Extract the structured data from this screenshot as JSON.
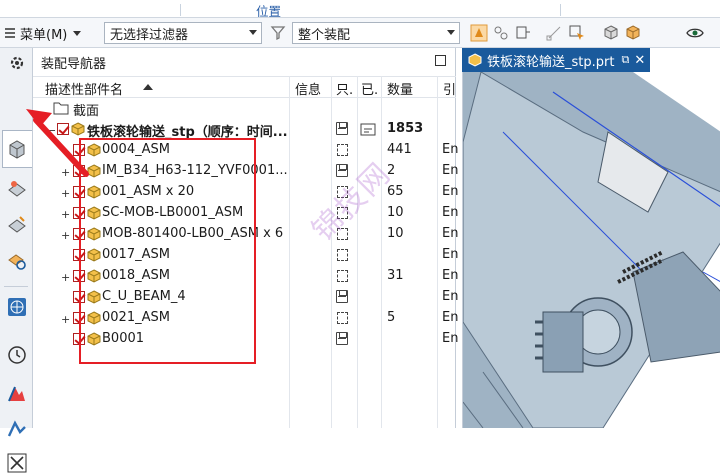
{
  "topbar": {
    "location_label": "位置"
  },
  "toolbar": {
    "menu_label": "菜单(M)",
    "filter_value": "无选择过滤器",
    "scope_value": "整个装配"
  },
  "navigator": {
    "title": "装配导航器",
    "columns": {
      "name": "描述性部件名",
      "info": "信息",
      "readonly": "只.",
      "modified": "已.",
      "quantity": "数量",
      "ref": "引"
    },
    "section_label": "截面",
    "root": {
      "name": "铁板滚轮输送_stp（顺序：时间...",
      "quantity": "1853"
    },
    "items": [
      {
        "name": "0004_ASM",
        "quantity": "441",
        "ref": "En"
      },
      {
        "name": "IM_B34_H63-112_YVF0001...",
        "quantity": "2",
        "ref": "En"
      },
      {
        "name": "001_ASM x 20",
        "quantity": "65",
        "ref": "En"
      },
      {
        "name": "SC-MOB-LB0001_ASM",
        "quantity": "10",
        "ref": "En"
      },
      {
        "name": "MOB-801400-LB00_ASM x 6",
        "quantity": "10",
        "ref": "En"
      },
      {
        "name": "0017_ASM",
        "quantity": "",
        "ref": "En"
      },
      {
        "name": "0018_ASM",
        "quantity": "31",
        "ref": "En"
      },
      {
        "name": "C_U_BEAM_4",
        "quantity": "",
        "ref": "En"
      },
      {
        "name": "0021_ASM",
        "quantity": "5",
        "ref": "En"
      },
      {
        "name": "B0001",
        "quantity": "",
        "ref": "En"
      }
    ],
    "watermark": "锦技网"
  },
  "graphics": {
    "tab_title": "铁板滚轮输送_stp.prt"
  },
  "colors": {
    "accent": "#1a5a9c",
    "highlight": "#e51e25"
  }
}
